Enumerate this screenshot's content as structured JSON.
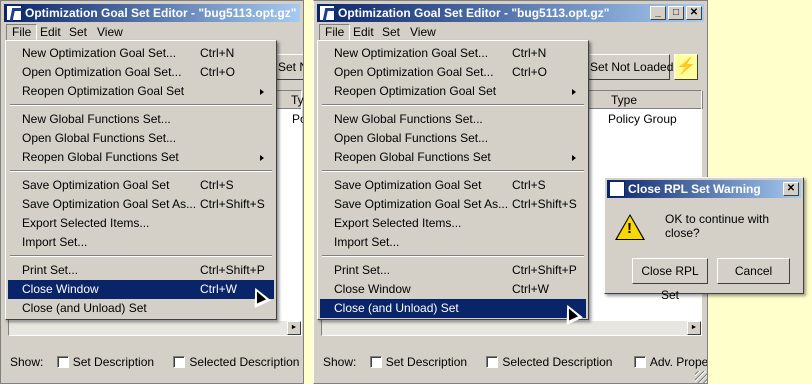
{
  "left_window": {
    "title": "Optimization Goal Set Editor - \"bug5113.opt.gz\"",
    "menubar": [
      "File",
      "Edit",
      "Set",
      "View"
    ],
    "toolbar_button": "Set N",
    "column_partial": "Ty",
    "row_partial": "Po",
    "show_label": "Show:",
    "checkboxes": [
      "Set Description",
      "Selected Description"
    ],
    "file_menu": {
      "items": [
        {
          "label": "New Optimization Goal Set...",
          "accel": "Ctrl+N"
        },
        {
          "label": "Open Optimization Goal Set...",
          "accel": "Ctrl+O"
        },
        {
          "label": "Reopen Optimization Goal Set",
          "accel": ""
        },
        {
          "label": "New Global Functions Set...",
          "accel": ""
        },
        {
          "label": "Open Global Functions Set...",
          "accel": ""
        },
        {
          "label": "Reopen Global Functions Set",
          "accel": ""
        },
        {
          "label": "Save Optimization Goal Set",
          "accel": "Ctrl+S"
        },
        {
          "label": "Save Optimization Goal Set As...",
          "accel": "Ctrl+Shift+S"
        },
        {
          "label": "Export Selected Items...",
          "accel": ""
        },
        {
          "label": "Import Set...",
          "accel": ""
        },
        {
          "label": "Print Set...",
          "accel": "Ctrl+Shift+P"
        },
        {
          "label": "Close Window",
          "accel": "Ctrl+W"
        },
        {
          "label": "Close (and Unload) Set",
          "accel": ""
        }
      ]
    }
  },
  "right_window": {
    "title": "Optimization Goal Set Editor - \"bug5113.opt.gz\"",
    "menubar": [
      "File",
      "Edit",
      "Set",
      "View"
    ],
    "toolbar_button": "Set Not Loaded",
    "column_header": "Type",
    "row_value": "Policy Group",
    "show_label": "Show:",
    "checkboxes": [
      "Set Description",
      "Selected Description",
      "Adv. Properties"
    ],
    "file_menu": {
      "items": [
        {
          "label": "New Optimization Goal Set...",
          "accel": "Ctrl+N"
        },
        {
          "label": "Open Optimization Goal Set...",
          "accel": "Ctrl+O"
        },
        {
          "label": "Reopen Optimization Goal Set",
          "accel": ""
        },
        {
          "label": "New Global Functions Set...",
          "accel": ""
        },
        {
          "label": "Open Global Functions Set...",
          "accel": ""
        },
        {
          "label": "Reopen Global Functions Set",
          "accel": ""
        },
        {
          "label": "Save Optimization Goal Set",
          "accel": "Ctrl+S"
        },
        {
          "label": "Save Optimization Goal Set As...",
          "accel": "Ctrl+Shift+S"
        },
        {
          "label": "Export Selected Items...",
          "accel": ""
        },
        {
          "label": "Import Set...",
          "accel": ""
        },
        {
          "label": "Print Set...",
          "accel": "Ctrl+Shift+P"
        },
        {
          "label": "Close Window",
          "accel": "Ctrl+W"
        },
        {
          "label": "Close (and Unload) Set",
          "accel": ""
        }
      ]
    }
  },
  "dialog": {
    "title": "Close RPL Set Warning",
    "message": "OK to continue with close?",
    "ok_label": "Close RPL Set",
    "cancel_label": "Cancel",
    "close_glyph": "✕"
  },
  "caption_glyphs": {
    "minimize": "_",
    "maximize": "□",
    "close": "✕"
  },
  "colors": {
    "highlight": "#0a246a",
    "title_gradient_end": "#a6caf0",
    "background": "#ffffcc",
    "window_face": "#d4d0c8"
  }
}
